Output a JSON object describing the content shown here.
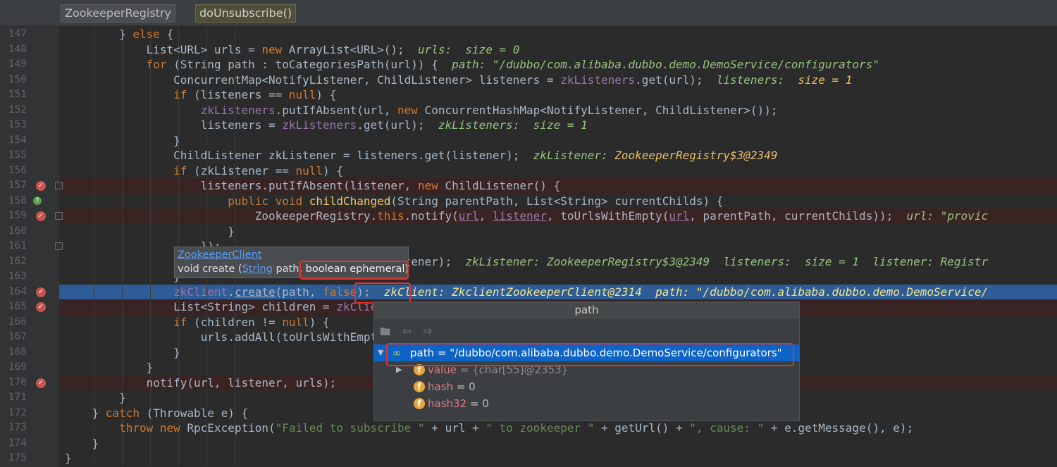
{
  "breadcrumbs": [
    "ZookeeperRegistry",
    "doUnsubscribe()"
  ],
  "lines": [
    {
      "n": "147",
      "bp": false,
      "sel": false,
      "html": "        } <span class=\"kw\">else</span> {"
    },
    {
      "n": "148",
      "bp": false,
      "sel": false,
      "html": "            List&lt;URL&gt; urls = <span class=\"kw\">new</span> ArrayList&lt;URL&gt;();  <span class=\"inl\">urls:  size = 0</span>"
    },
    {
      "n": "149",
      "bp": false,
      "sel": false,
      "html": "            <span class=\"kw\">for</span> (String path : toCategoriesPath(url)) {  <span class=\"inl\">path: \"/dubbo/com.alibaba.dubbo.demo.DemoService/configurators\"</span>"
    },
    {
      "n": "150",
      "bp": false,
      "sel": false,
      "html": "                ConcurrentMap&lt;NotifyListener, ChildListener&gt; listeners = <span class=\"fld\">zkListeners</span>.get(url);  <span class=\"inl\">listeners:  <span class=\"v\">size = 1</span></span>"
    },
    {
      "n": "151",
      "bp": false,
      "sel": false,
      "html": "                <span class=\"kw\">if</span> (listeners == <span class=\"kw\">null</span>) {"
    },
    {
      "n": "152",
      "bp": false,
      "sel": false,
      "html": "                    <span class=\"fld\">zkListeners</span>.putIfAbsent(url, <span class=\"kw\">new</span> ConcurrentHashMap&lt;NotifyListener, ChildListener&gt;());"
    },
    {
      "n": "153",
      "bp": false,
      "sel": false,
      "html": "                    listeners = <span class=\"fld\">zkListeners</span>.get(url);  <span class=\"inl\">zkListeners:  size = 1</span>"
    },
    {
      "n": "154",
      "bp": false,
      "sel": false,
      "html": "                }"
    },
    {
      "n": "155",
      "bp": false,
      "sel": false,
      "html": "                ChildListener zkListener = listeners.get(listener);  <span class=\"inl\">zkListener: <span class=\"v\">ZookeeperRegistry$3@2349</span></span>"
    },
    {
      "n": "156",
      "bp": false,
      "sel": false,
      "html": "                <span class=\"kw\">if</span> (zkListener == <span class=\"kw\">null</span>) {"
    },
    {
      "n": "157",
      "bp": true,
      "sel": false,
      "html": "                    listeners.putIfAbsent(listener, <span class=\"kw\">new</span> ChildListener() {"
    },
    {
      "n": "158",
      "bp": false,
      "sel": false,
      "override": true,
      "html": "                        <span class=\"kw\">public void</span> <span class=\"fn\">childChanged</span>(String parentPath, List&lt;String&gt; currentChilds) {"
    },
    {
      "n": "159",
      "bp": true,
      "sel": false,
      "html": "                            ZookeeperRegistry.<span class=\"kw\">this</span>.notify(<span class=\"fld ul\">url</span>, <span class=\"fld ul\">listener</span>, toUrlsWithEmpty(<span class=\"fld ul\">url</span>, parentPath, currentChilds));  <span class=\"inl\">url: \"provic</span>"
    },
    {
      "n": "160",
      "bp": false,
      "sel": false,
      "html": "                        }"
    },
    {
      "n": "161",
      "bp": false,
      "sel": false,
      "html": "                    });"
    },
    {
      "n": "162",
      "bp": false,
      "sel": false,
      "html": "                    zkListener = listeners.get(listener);  <span class=\"inl\">zkListener: ZookeeperRegistry$3@2349  listeners:  size = 1  listener: Registr</span>"
    },
    {
      "n": "163",
      "bp": false,
      "sel": false,
      "html": "                }"
    },
    {
      "n": "164",
      "bp": true,
      "sel": true,
      "html": "                <span class=\"fld\">zkClient</span>.<span class=\"ul\">create</span>(path, <span class=\"kw\">false</span>);  <span class=\"inl\">zkClient: ZkclientZookeeperClient@2314  path: \"/dubbo/com.alibaba.dubbo.demo.DemoService/</span>"
    },
    {
      "n": "165",
      "bp": true,
      "sel": false,
      "html": "                List&lt;String&gt; children = <span class=\"fld\">zkClient</span>.addChildListener(path, zkListener);"
    },
    {
      "n": "166",
      "bp": false,
      "sel": false,
      "html": "                <span class=\"kw\">if</span> (children != <span class=\"kw\">null</span>) {"
    },
    {
      "n": "167",
      "bp": false,
      "sel": false,
      "html": "                    urls.addAll(toUrlsWithEmpty(url, path, children));"
    },
    {
      "n": "168",
      "bp": false,
      "sel": false,
      "html": "                }"
    },
    {
      "n": "169",
      "bp": false,
      "sel": false,
      "html": "            }"
    },
    {
      "n": "170",
      "bp": true,
      "sel": false,
      "html": "            notify(url, listener, urls);"
    },
    {
      "n": "171",
      "bp": false,
      "sel": false,
      "html": "        }"
    },
    {
      "n": "172",
      "bp": false,
      "sel": false,
      "html": "    } <span class=\"kw\">catch</span> (Throwable e) {"
    },
    {
      "n": "173",
      "bp": false,
      "sel": false,
      "html": "        <span class=\"kw\">throw new</span> RpcException(<span class=\"str\">\"Failed to subscribe \"</span> + url + <span class=\"str\">\" to zookeeper \"</span> + getUrl() + <span class=\"str\">\", cause: \"</span> + e.getMessage(), e);"
    },
    {
      "n": "174",
      "bp": false,
      "sel": false,
      "html": "    }"
    },
    {
      "n": "175",
      "bp": false,
      "sel": false,
      "html": "}"
    }
  ],
  "hint": {
    "link": "ZookeeperClient",
    "sig_prefix": "void create (",
    "sig_type": "String",
    "sig_mid": " path, ",
    "sig_highlight": "boolean ephemeral",
    "sig_suffix": ")"
  },
  "watch": {
    "title": "path",
    "rows": [
      {
        "name": "path",
        "value": " = \"/dubbo/com.alibaba.dubbo.demo.DemoService/configurators\""
      },
      {
        "name": "value",
        "value": " = {char[55]@2353}"
      },
      {
        "name": "hash",
        "value": " = 0"
      },
      {
        "name": "hash32",
        "value": " = 0"
      }
    ]
  }
}
